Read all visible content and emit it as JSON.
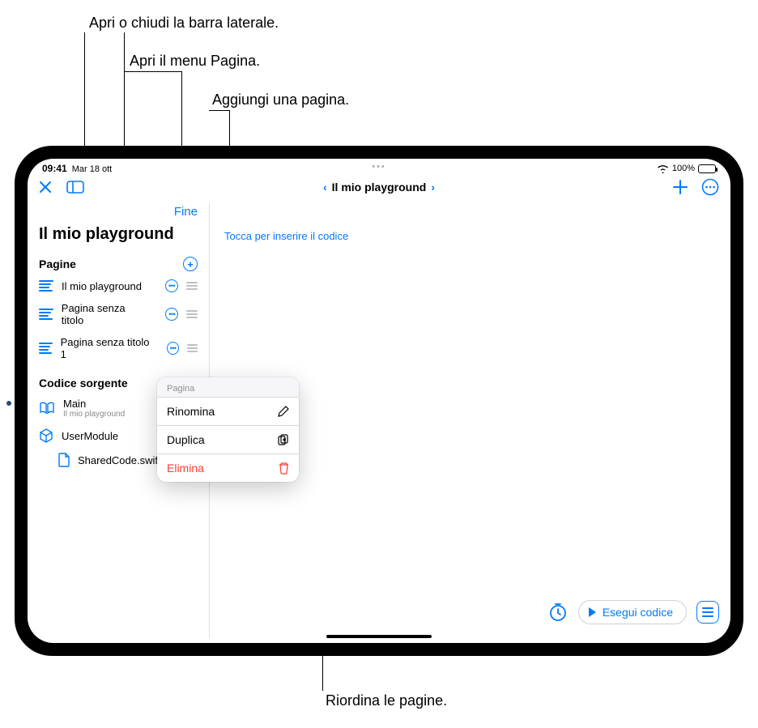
{
  "callouts": {
    "c1": "Apri o chiudi la barra laterale.",
    "c2": "Apri il menu Pagina.",
    "c3": "Aggiungi una pagina.",
    "c4": "Riordina le pagine."
  },
  "status": {
    "time": "09:41",
    "date": "Mar 18 ott",
    "battery": "100%"
  },
  "toolbar": {
    "title": "Il mio playground"
  },
  "sidebar": {
    "done": "Fine",
    "title": "Il mio playground",
    "pages_section": "Pagine",
    "pages": [
      {
        "label": "Il mio playground"
      },
      {
        "label": "Pagina senza titolo"
      },
      {
        "label": "Pagina senza titolo 1"
      }
    ],
    "source_section": "Codice sorgente",
    "main_label": "Main",
    "main_sub": "Il mio playground",
    "module_label": "UserModule",
    "file_label": "SharedCode.swift"
  },
  "context_menu": {
    "header": "Pagina",
    "rename": "Rinomina",
    "duplicate": "Duplica",
    "delete": "Elimina"
  },
  "editor": {
    "placeholder": "Tocca per inserire il codice"
  },
  "bottombar": {
    "run": "Esegui codice"
  }
}
